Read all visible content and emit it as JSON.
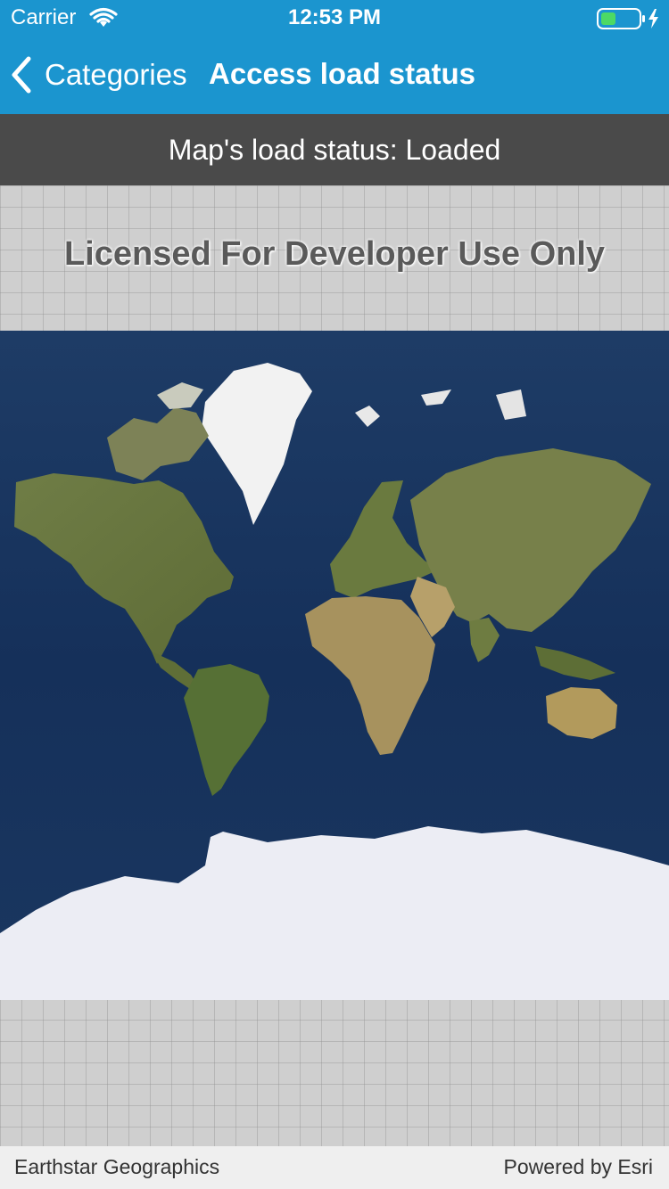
{
  "status_bar": {
    "carrier": "Carrier",
    "time": "12:53 PM",
    "wifi_icon": "wifi-icon",
    "battery_icon": "battery-charging-icon",
    "battery_color": "#4cd964"
  },
  "nav_bar": {
    "back_label": "Categories",
    "back_icon": "chevron-left-icon",
    "title": "Access load status",
    "background_color": "#1b95cf"
  },
  "banner": {
    "text": "Map's load status: Loaded",
    "background_color": "#4a4a4a"
  },
  "map": {
    "watermark": "Licensed For Developer Use Only",
    "basemap": "World Imagery"
  },
  "attribution": {
    "left": "Earthstar Geographics",
    "right": "Powered by Esri"
  }
}
